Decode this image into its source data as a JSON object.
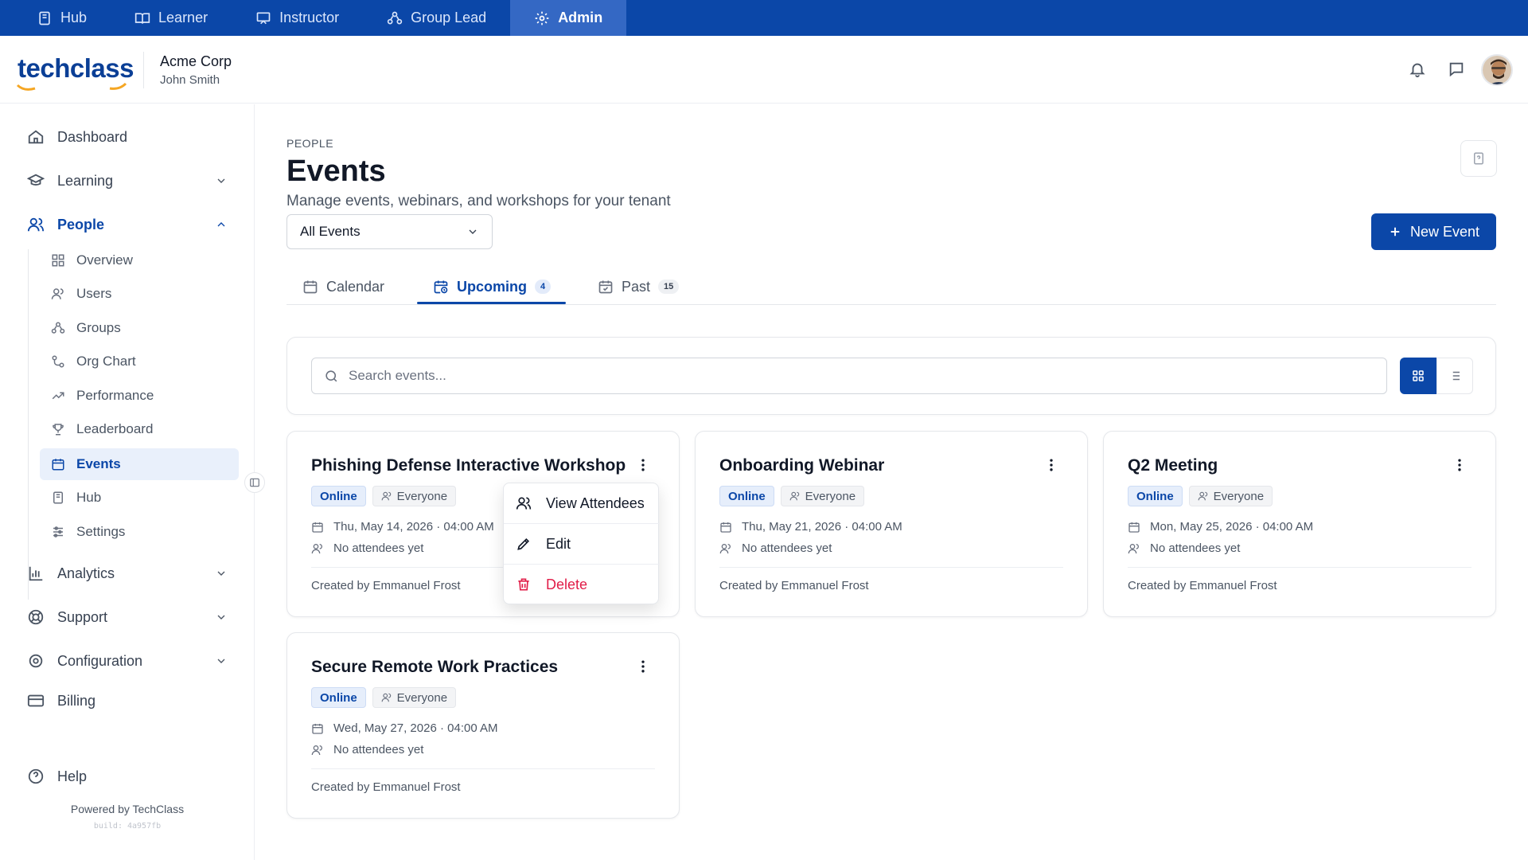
{
  "roles": [
    {
      "label": "Hub",
      "icon": "book-icon"
    },
    {
      "label": "Learner",
      "icon": "open-book-icon"
    },
    {
      "label": "Instructor",
      "icon": "presentation-icon"
    },
    {
      "label": "Group Lead",
      "icon": "group-icon"
    },
    {
      "label": "Admin",
      "icon": "gear-icon",
      "active": true
    }
  ],
  "header": {
    "logo_text": "techclass",
    "org_name": "Acme Corp",
    "user_name": "John Smith",
    "icons": [
      "bell-icon",
      "chat-icon"
    ]
  },
  "sidebar": {
    "items": [
      {
        "label": "Dashboard",
        "icon": "home-icon"
      },
      {
        "label": "Learning",
        "icon": "graduation-cap-icon",
        "expandable": true
      },
      {
        "label": "People",
        "icon": "users-icon",
        "expanded": true,
        "active": true
      },
      {
        "label": "Analytics",
        "icon": "bar-chart-icon",
        "expandable": true
      },
      {
        "label": "Support",
        "icon": "lifebuoy-icon",
        "expandable": true
      },
      {
        "label": "Configuration",
        "icon": "gear-icon",
        "expandable": true
      },
      {
        "label": "Billing",
        "icon": "credit-card-icon"
      }
    ],
    "people_sub": [
      {
        "label": "Overview",
        "icon": "grid-icon"
      },
      {
        "label": "Users",
        "icon": "users-icon"
      },
      {
        "label": "Groups",
        "icon": "group-icon"
      },
      {
        "label": "Org Chart",
        "icon": "org-chart-icon"
      },
      {
        "label": "Performance",
        "icon": "trend-icon"
      },
      {
        "label": "Leaderboard",
        "icon": "trophy-icon"
      },
      {
        "label": "Events",
        "icon": "calendar-icon",
        "active": true
      },
      {
        "label": "Hub",
        "icon": "book-icon"
      },
      {
        "label": "Settings",
        "icon": "sliders-icon"
      }
    ],
    "help_label": "Help",
    "powered_by": "Powered by TechClass",
    "build": "build: 4a957fb"
  },
  "main": {
    "breadcrumb": "PEOPLE",
    "title": "Events",
    "subtitle": "Manage events, webinars, and workshops for your tenant",
    "filter_value": "All Events",
    "new_button": "New Event",
    "tabs": [
      {
        "label": "Calendar",
        "count": ""
      },
      {
        "label": "Upcoming",
        "count": "4",
        "active": true
      },
      {
        "label": "Past",
        "count": "15"
      }
    ],
    "search_placeholder": "Search events..."
  },
  "events": [
    {
      "title": "Phishing Defense Interactive Workshop",
      "mode": "Online",
      "audience": "Everyone",
      "datetime": "Thu, May 14, 2026 · 04:00 AM",
      "attendees": "No attendees yet",
      "created_by": "Created by Emmanuel Frost"
    },
    {
      "title": "Onboarding Webinar",
      "mode": "Online",
      "audience": "Everyone",
      "datetime": "Thu, May 21, 2026 · 04:00 AM",
      "attendees": "No attendees yet",
      "created_by": "Created by Emmanuel Frost"
    },
    {
      "title": "Q2 Meeting",
      "mode": "Online",
      "audience": "Everyone",
      "datetime": "Mon, May 25, 2026 · 04:00 AM",
      "attendees": "No attendees yet",
      "created_by": "Created by Emmanuel Frost"
    },
    {
      "title": "Secure Remote Work Practices",
      "mode": "Online",
      "audience": "Everyone",
      "datetime": "Wed, May 27, 2026 · 04:00 AM",
      "attendees": "No attendees yet",
      "created_by": "Created by Emmanuel Frost"
    }
  ],
  "context_menu": {
    "items": [
      {
        "label": "View Attendees",
        "icon": "users-icon"
      },
      {
        "label": "Edit",
        "icon": "pencil-icon"
      },
      {
        "label": "Delete",
        "icon": "trash-icon",
        "danger": true
      }
    ]
  },
  "colors": {
    "primary": "#0b47a8",
    "danger": "#e11d48",
    "accent_orange": "#f5a623"
  }
}
